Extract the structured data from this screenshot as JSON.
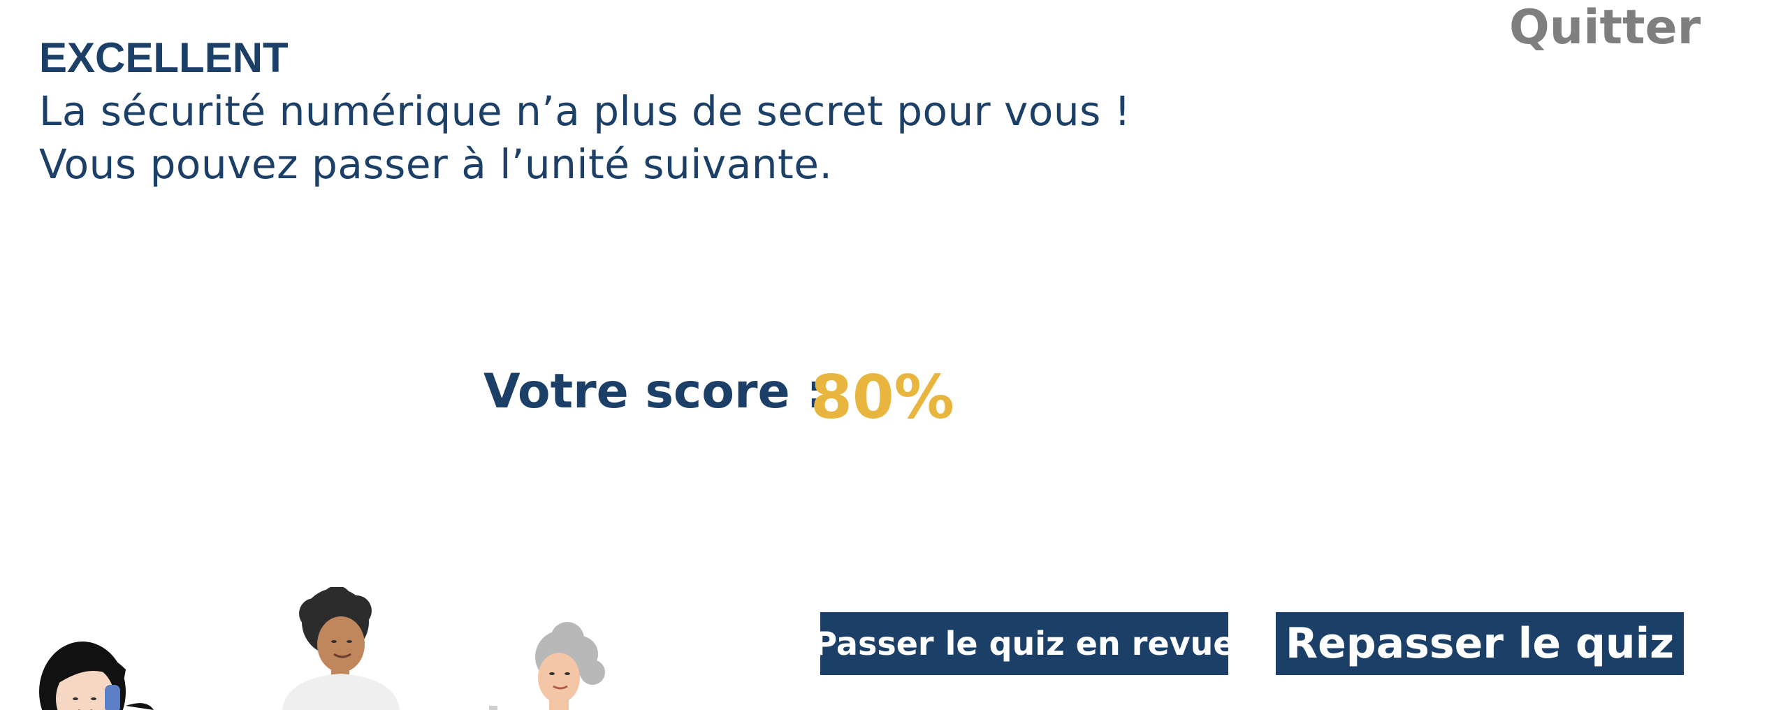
{
  "header": {
    "quit_label": "Quitter"
  },
  "result": {
    "heading": "EXCELLENT",
    "line1": "La sécurité numérique n’a plus de secret pour vous !",
    "line2": "Vous pouvez passer à l’unité suivante."
  },
  "score": {
    "label": "Votre score :",
    "value": "80%"
  },
  "actions": {
    "review_label": "Passer le quiz en revue",
    "retake_label": "Repasser le quiz"
  },
  "colors": {
    "primary_navy": "#1b3f66",
    "score_gold": "#e8b53e",
    "quit_gray": "#7f7f7f"
  },
  "illustration": {
    "icon": "people-illustration",
    "figures": [
      "woman-phone-figure",
      "man-figure",
      "elderly-woman-figure"
    ]
  }
}
